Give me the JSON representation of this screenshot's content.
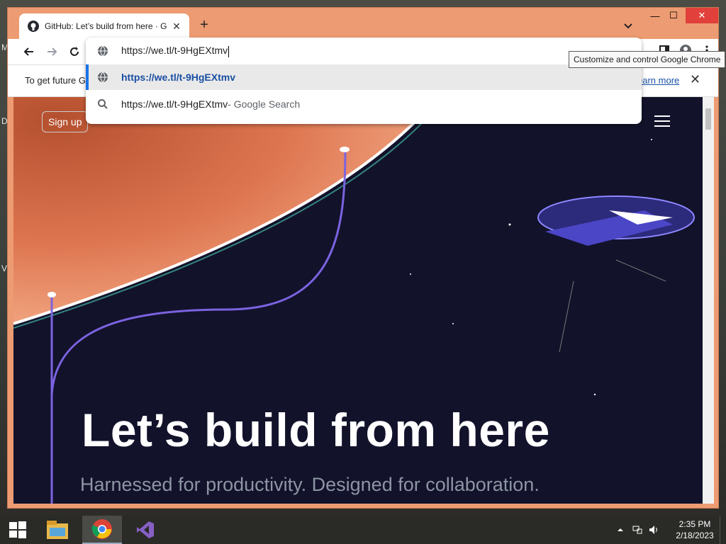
{
  "desktop": {
    "side_letters": [
      "M",
      "D",
      "V"
    ]
  },
  "browser": {
    "tab": {
      "title": "GitHub: Let’s build from here · GitHub",
      "close_glyph": "✕"
    },
    "newtab_glyph": "+",
    "window_controls": {
      "minimize": "—",
      "maximize": "☐",
      "close": "✕"
    },
    "address": {
      "value": "https://we.tl/t-9HgEXtmv"
    },
    "suggestions": [
      {
        "text": "https://we.tl/t-9HgEXtmv",
        "icon": "globe-icon"
      },
      {
        "text": "https://we.tl/t-9HgEXtmv",
        "suffix": " - Google Search",
        "icon": "search-icon"
      }
    ],
    "tooltip": "Customize and control Google Chrome",
    "infobar": {
      "text": "To get future G",
      "link": "earn more",
      "close_glyph": "✕"
    }
  },
  "page": {
    "signup": "Sign up",
    "hero_title": "Let’s build from here",
    "hero_subtitle": "Harnessed for productivity. Designed for collaboration."
  },
  "taskbar": {
    "time": "2:35 PM",
    "date": "2/18/2023",
    "apps": [
      "start-icon",
      "file-explorer-icon",
      "chrome-icon",
      "visual-studio-icon"
    ]
  },
  "colors": {
    "window_frame": "#ed9b72",
    "hero_bg": "#0f1029",
    "close_red": "#e2403b",
    "link_blue": "#1a4fa3"
  }
}
